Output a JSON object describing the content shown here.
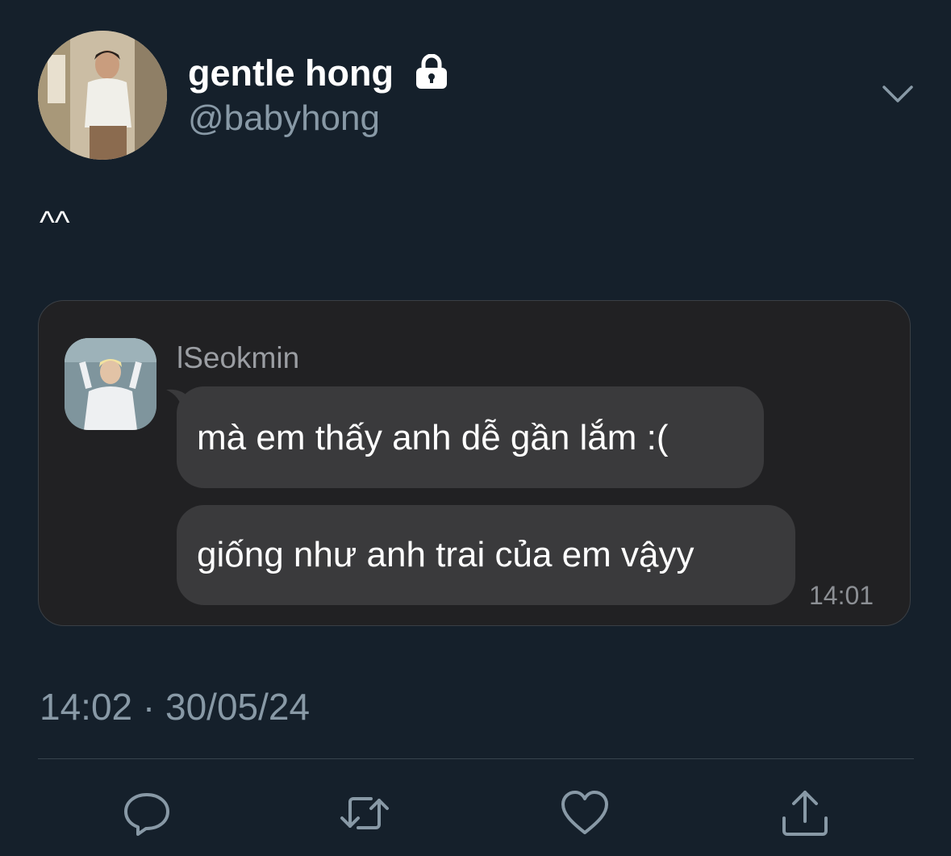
{
  "tweet": {
    "author": {
      "display_name": "gentle hong",
      "handle": "@babyhong",
      "avatar_icon": "profile-photo",
      "locked_icon": "lock-icon"
    },
    "text": "^^",
    "timestamp": "14:02 · 30/05/24"
  },
  "embedded_chat": {
    "sender": "lSeokmin",
    "avatar_icon": "profile-photo",
    "messages": [
      {
        "text": "mà em thấy anh dễ gần lắm :("
      },
      {
        "text": "giống như anh trai của em vậyy"
      }
    ],
    "time": "14:01"
  },
  "actions": [
    {
      "name": "reply",
      "icon": "comment-icon"
    },
    {
      "name": "retweet",
      "icon": "retweet-icon"
    },
    {
      "name": "like",
      "icon": "heart-icon"
    },
    {
      "name": "share",
      "icon": "share-icon"
    }
  ],
  "colors": {
    "background": "#15202b",
    "card": "#212123",
    "bubble": "#3a3a3c",
    "secondary_text": "#8899a6",
    "icon": "#8899a6"
  }
}
